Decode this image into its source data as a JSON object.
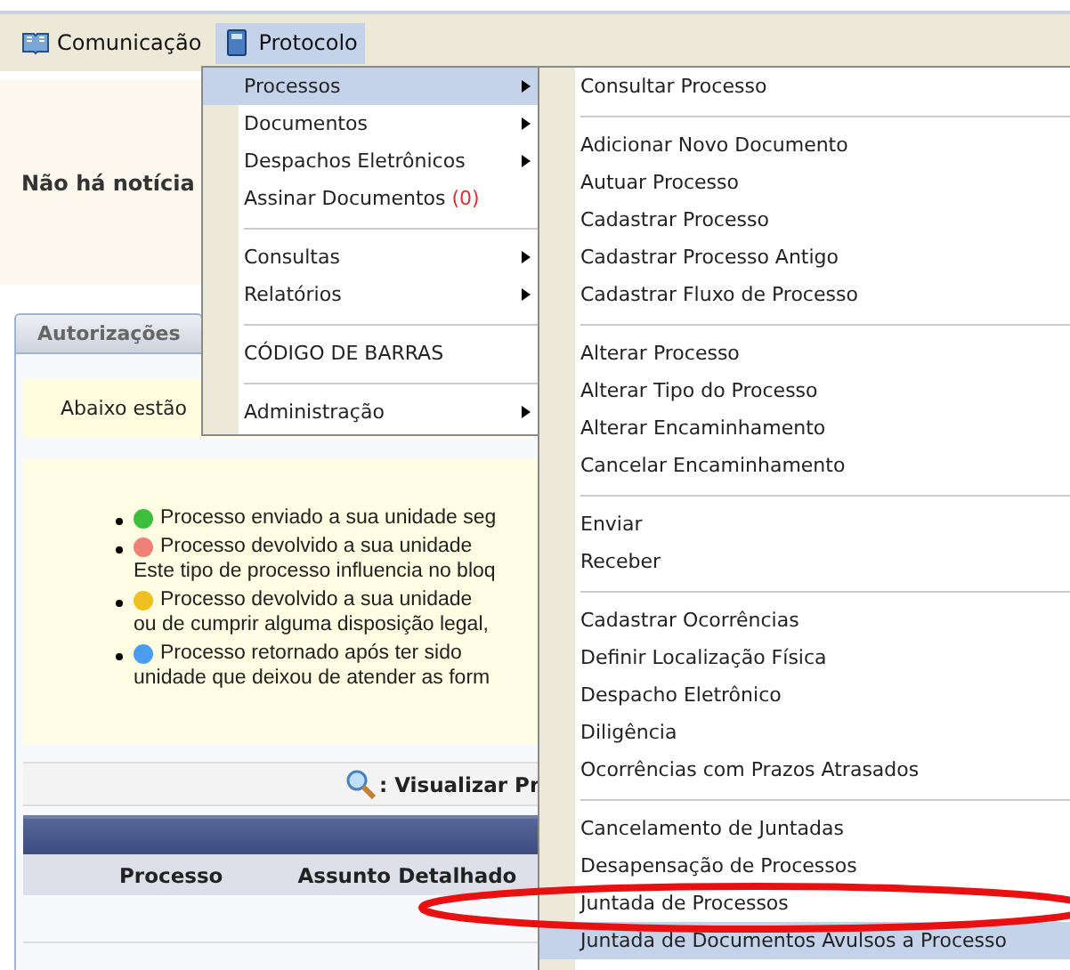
{
  "menubar": [
    {
      "label": "Comunicação",
      "selected": false
    },
    {
      "label": "Protocolo",
      "selected": true
    }
  ],
  "notice": "Não há notícia",
  "tabs": [
    {
      "label": "Autorizações",
      "selected": false
    }
  ],
  "intro": "Abaixo estão",
  "legend": [
    {
      "color": "#3cbf3c",
      "lines": [
        "Processo enviado a sua unidade seg"
      ]
    },
    {
      "color": "#f08078",
      "lines": [
        "Processo devolvido a sua unidade",
        "Este tipo de processo influencia no bloq"
      ]
    },
    {
      "color": "#f0c020",
      "lines": [
        "Processo devolvido a sua unidade",
        "ou de cumprir alguma disposição legal,"
      ]
    },
    {
      "color": "#4a9ef0",
      "lines": [
        "Processo retornado após ter sido",
        "unidade que deixou de atender as form"
      ]
    }
  ],
  "view_bar": ": Visualizar Pr",
  "table": {
    "columns": [
      "Processo",
      "Assunto Detalhado"
    ]
  },
  "dropdown": {
    "items": [
      {
        "kind": "item",
        "label": "Processos",
        "has_submenu": true,
        "selected": true
      },
      {
        "kind": "item",
        "label": "Documentos",
        "has_submenu": true,
        "selected": false
      },
      {
        "kind": "item",
        "label": "Despachos Eletrônicos",
        "has_submenu": true,
        "selected": false
      },
      {
        "kind": "item",
        "label": "Assinar Documentos",
        "count": "(0)",
        "has_submenu": false,
        "selected": false
      },
      {
        "kind": "separator"
      },
      {
        "kind": "item",
        "label": "Consultas",
        "has_submenu": true,
        "selected": false
      },
      {
        "kind": "item",
        "label": "Relatórios",
        "has_submenu": true,
        "selected": false
      },
      {
        "kind": "separator"
      },
      {
        "kind": "item",
        "label": "CÓDIGO DE BARRAS",
        "has_submenu": false,
        "selected": false
      },
      {
        "kind": "separator"
      },
      {
        "kind": "item",
        "label": "Administração",
        "has_submenu": true,
        "selected": false
      }
    ]
  },
  "submenu": {
    "items": [
      {
        "kind": "item",
        "label": "Consultar Processo",
        "selected": false
      },
      {
        "kind": "separator"
      },
      {
        "kind": "item",
        "label": "Adicionar Novo Documento",
        "selected": false
      },
      {
        "kind": "item",
        "label": "Autuar Processo",
        "selected": false
      },
      {
        "kind": "item",
        "label": "Cadastrar Processo",
        "selected": false
      },
      {
        "kind": "item",
        "label": "Cadastrar Processo Antigo",
        "selected": false
      },
      {
        "kind": "item",
        "label": "Cadastrar Fluxo de Processo",
        "selected": false
      },
      {
        "kind": "separator"
      },
      {
        "kind": "item",
        "label": "Alterar Processo",
        "selected": false
      },
      {
        "kind": "item",
        "label": "Alterar Tipo do Processo",
        "selected": false
      },
      {
        "kind": "item",
        "label": "Alterar Encaminhamento",
        "selected": false
      },
      {
        "kind": "item",
        "label": "Cancelar Encaminhamento",
        "selected": false
      },
      {
        "kind": "separator"
      },
      {
        "kind": "item",
        "label": "Enviar",
        "selected": false
      },
      {
        "kind": "item",
        "label": "Receber",
        "selected": false
      },
      {
        "kind": "separator"
      },
      {
        "kind": "item",
        "label": "Cadastrar Ocorrências",
        "selected": false
      },
      {
        "kind": "item",
        "label": "Definir Localização Física",
        "selected": false
      },
      {
        "kind": "item",
        "label": "Despacho Eletrônico",
        "selected": false
      },
      {
        "kind": "item",
        "label": "Diligência",
        "selected": false
      },
      {
        "kind": "item",
        "label": "Ocorrências com Prazos Atrasados",
        "selected": false
      },
      {
        "kind": "separator"
      },
      {
        "kind": "item",
        "label": "Cancelamento de Juntadas",
        "selected": false
      },
      {
        "kind": "item",
        "label": "Desapensação de Processos",
        "selected": false
      },
      {
        "kind": "item",
        "label": "Juntada de Processos",
        "selected": false
      },
      {
        "kind": "item",
        "label": "Juntada de Documentos Avulsos a Processo",
        "selected": true
      }
    ]
  },
  "annotation": {
    "kind": "ellipse"
  }
}
